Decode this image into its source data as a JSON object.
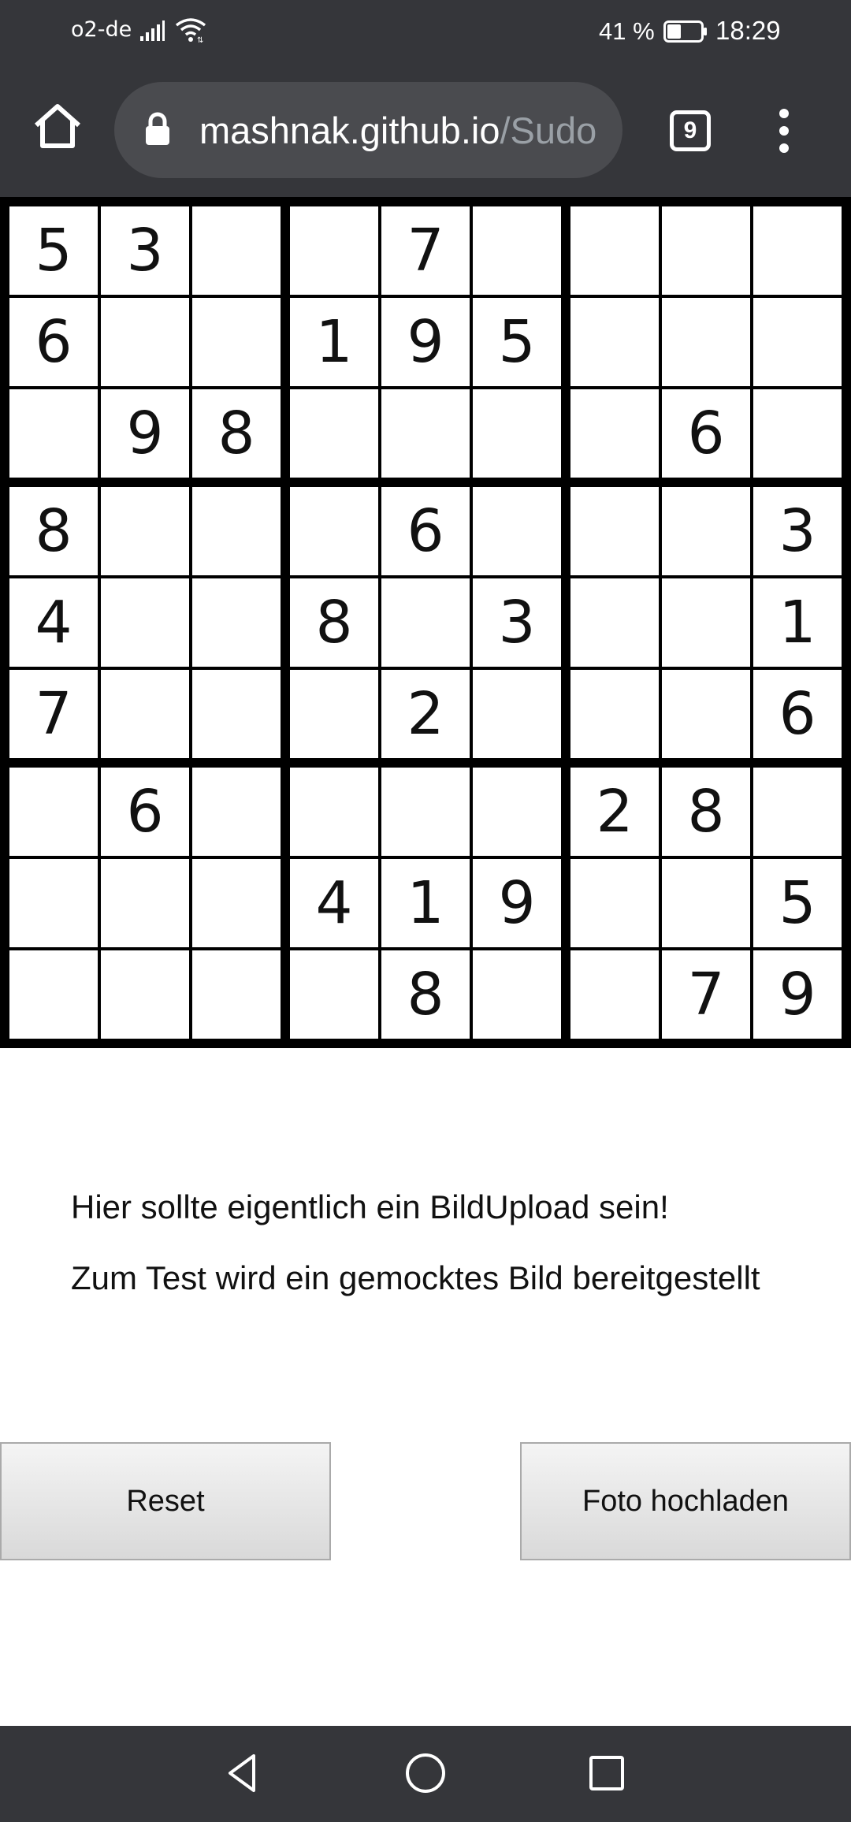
{
  "status_bar": {
    "carrier": "o2-de",
    "battery_percent": "41 %",
    "battery_level": 0.41,
    "time": "18:29",
    "icons": [
      "signal-icon",
      "wifi-icon",
      "battery-icon"
    ]
  },
  "browser": {
    "url_host": "mashnak.github.io",
    "url_path": "/Sudo",
    "tab_count": "9",
    "icons": [
      "home-icon",
      "lock-icon",
      "tabs-icon",
      "more-vert-icon"
    ]
  },
  "sudoku": {
    "rows": [
      [
        "5",
        "3",
        "",
        "",
        "7",
        "",
        "",
        "",
        ""
      ],
      [
        "6",
        "",
        "",
        "1",
        "9",
        "5",
        "",
        "",
        ""
      ],
      [
        "",
        "9",
        "8",
        "",
        "",
        "",
        "",
        "6",
        ""
      ],
      [
        "8",
        "",
        "",
        "",
        "6",
        "",
        "",
        "",
        "3"
      ],
      [
        "4",
        "",
        "",
        "8",
        "",
        "3",
        "",
        "",
        "1"
      ],
      [
        "7",
        "",
        "",
        "",
        "2",
        "",
        "",
        "",
        "6"
      ],
      [
        "",
        "6",
        "",
        "",
        "",
        "",
        "2",
        "8",
        ""
      ],
      [
        "",
        "",
        "",
        "4",
        "1",
        "9",
        "",
        "",
        "5"
      ],
      [
        "",
        "",
        "",
        "",
        "8",
        "",
        "",
        "7",
        "9"
      ]
    ]
  },
  "info": {
    "line1": "Hier sollte eigentlich ein BildUpload sein!",
    "line2": "Zum Test wird ein gemocktes Bild bereitgestellt"
  },
  "buttons": {
    "reset": "Reset",
    "upload": "Foto hochladen"
  },
  "nav_bar": {
    "icons": [
      "back-icon",
      "home-circle-icon",
      "recents-icon"
    ]
  },
  "colors": {
    "chrome_dark": "#35363a",
    "url_bar": "#4a4b4f",
    "url_path_gray": "#9aa0a6"
  }
}
